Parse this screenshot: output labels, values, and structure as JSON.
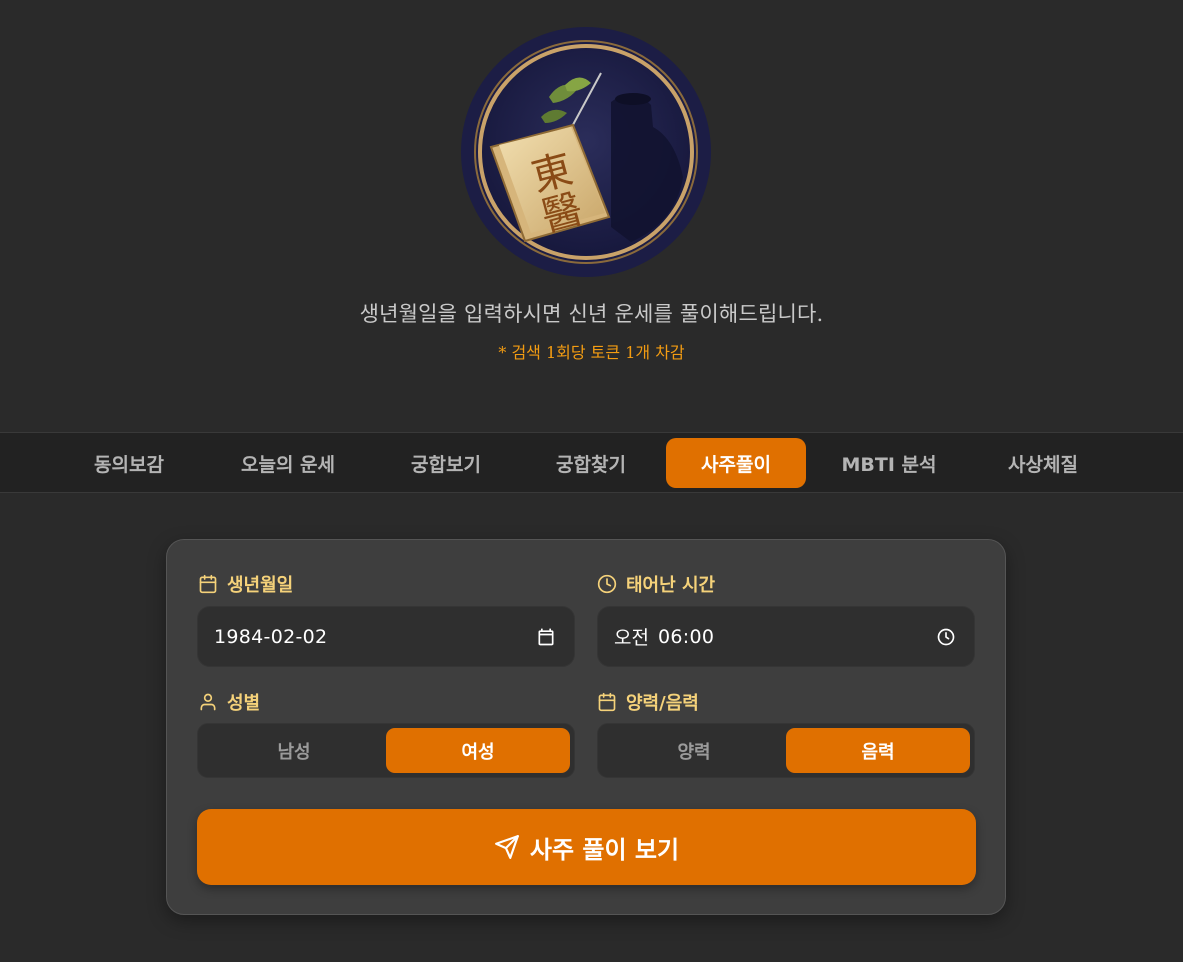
{
  "hero": {
    "logo_text_top": "東",
    "logo_text_bottom": "醫",
    "subtitle": "생년월일을 입력하시면 신년 운세를 풀이해드립니다.",
    "token_note": "* 검색 1회당 토큰 1개 차감"
  },
  "nav": {
    "tabs": [
      {
        "label": "동의보감"
      },
      {
        "label": "오늘의 운세"
      },
      {
        "label": "궁합보기"
      },
      {
        "label": "궁합찾기"
      },
      {
        "label": "사주풀이",
        "active": true
      },
      {
        "label": "MBTI 분석"
      },
      {
        "label": "사상체질"
      }
    ]
  },
  "form": {
    "birthdate_label": "생년월일",
    "birthdate_value": "1984-02-02",
    "birthtime_label": "태어난 시간",
    "birthtime_ampm": "오전",
    "birthtime_value": "06:00",
    "gender_label": "성별",
    "gender_options": [
      "남성",
      "여성"
    ],
    "gender_selected": "여성",
    "calendar_label": "양력/음력",
    "calendar_options": [
      "양력",
      "음력"
    ],
    "calendar_selected": "음력",
    "submit_label": "사주 풀이 보기"
  },
  "colors": {
    "accent": "#e07000",
    "label": "#f5d27a",
    "note": "#f39c12",
    "background": "#2a2a2a",
    "card": "#3e3e3e"
  },
  "icons": {
    "birthdate": "calendar-icon",
    "birthtime": "clock-icon",
    "gender": "user-icon",
    "calendar": "calendar-icon",
    "submit": "send-icon"
  }
}
